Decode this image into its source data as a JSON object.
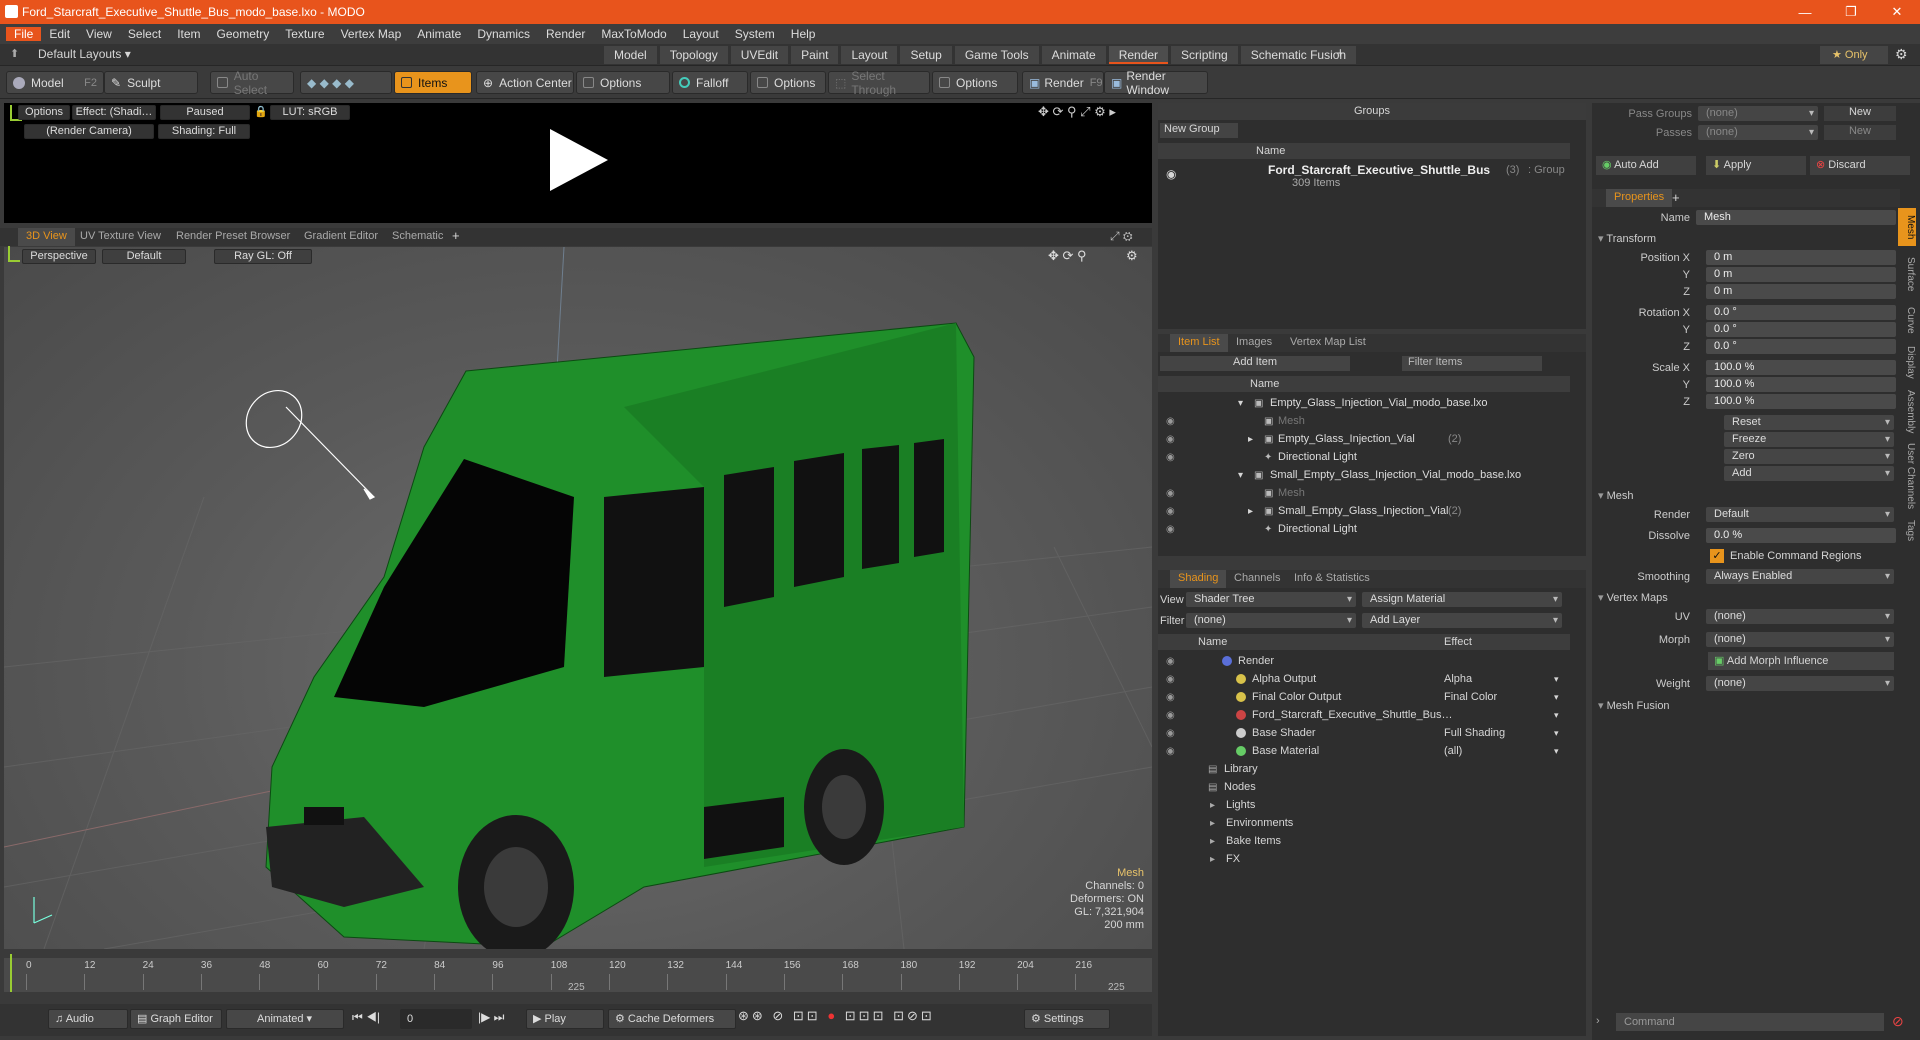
{
  "window": {
    "title": "Ford_Starcraft_Executive_Shuttle_Bus_modo_base.lxo - MODO",
    "min": "—",
    "max": "❐",
    "close": "✕"
  },
  "menu": [
    "File",
    "Edit",
    "View",
    "Select",
    "Item",
    "Geometry",
    "Texture",
    "Vertex Map",
    "Animate",
    "Dynamics",
    "Render",
    "MaxToModo",
    "Layout",
    "System",
    "Help"
  ],
  "layouts": {
    "label": "Default Layouts ▾",
    "tabs": [
      "Model",
      "Topology",
      "UVEdit",
      "Paint",
      "Layout",
      "Setup",
      "Game Tools",
      "Animate",
      "Render",
      "Scripting",
      "Schematic Fusion"
    ],
    "active": "Render",
    "plus": "+",
    "only": "★  Only"
  },
  "toolbar": {
    "model": "Model",
    "model_key": "F2",
    "sculpt": "Sculpt",
    "auto_select": "Auto Select",
    "items": "Items",
    "action_center": "Action Center",
    "options1": "Options",
    "falloff": "Falloff",
    "options2": "Options",
    "select_through": "Select Through",
    "options3": "Options",
    "render": "Render",
    "render_key": "F9",
    "render_window": "Render Window"
  },
  "preview": {
    "options": "Options",
    "effect": "Effect: (Shadi…",
    "paused": "Paused",
    "lut": "LUT: sRGB",
    "camera": "(Render Camera)",
    "shading": "Shading: Full"
  },
  "viewport_tabs": [
    "3D View",
    "UV Texture View",
    "Render Preset Browser",
    "Gradient Editor",
    "Schematic"
  ],
  "viewport": {
    "perspective": "Perspective",
    "default": "Default",
    "raygl": "Ray GL: Off",
    "info": {
      "mesh": "Mesh",
      "channels": "Channels: 0",
      "deformers": "Deformers: ON",
      "gl": "GL: 7,321,904",
      "size": "200 mm"
    }
  },
  "timeline": {
    "ticks": [
      "0",
      "12",
      "24",
      "36",
      "48",
      "60",
      "72",
      "84",
      "96",
      "108",
      "120",
      "132",
      "144",
      "156",
      "168",
      "180",
      "192",
      "204",
      "216"
    ],
    "end_left": "225",
    "end_right": "225"
  },
  "bottom": {
    "audio": "Audio",
    "graph_editor": "Graph Editor",
    "animated": "Animated",
    "frame": "0",
    "play": "Play",
    "cache": "Cache Deformers",
    "settings": "Settings",
    "command": "Command"
  },
  "groups": {
    "title": "Groups",
    "new_group": "New Group",
    "col_name": "Name",
    "item_name": "Ford_Starcraft_Executive_Shuttle_Bus",
    "item_count": "(3)",
    "item_type": ": Group",
    "item_sub": "309 Items"
  },
  "item_list": {
    "tabs": [
      "Item List",
      "Images",
      "Vertex Map List"
    ],
    "add_item": "Add Item",
    "filter": "Filter Items",
    "col_name": "Name",
    "rows": [
      {
        "label": "Empty_Glass_Injection_Vial_modo_base.lxo",
        "indent": 0,
        "arrow": "▾"
      },
      {
        "label": "Mesh",
        "indent": 1,
        "dim": true
      },
      {
        "label": "Empty_Glass_Injection_Vial",
        "count": "(2)",
        "indent": 1,
        "arrow": "▸"
      },
      {
        "label": "Directional Light",
        "indent": 1
      },
      {
        "label": "Small_Empty_Glass_Injection_Vial_modo_base.lxo",
        "indent": 0,
        "arrow": "▾"
      },
      {
        "label": "Mesh",
        "indent": 1,
        "dim": true
      },
      {
        "label": "Small_Empty_Glass_Injection_Vial",
        "count": "(2)",
        "indent": 1,
        "arrow": "▸"
      },
      {
        "label": "Directional Light",
        "indent": 1
      }
    ]
  },
  "shading": {
    "tabs": [
      "Shading",
      "Channels",
      "Info & Statistics"
    ],
    "view_label": "View",
    "view_value": "Shader Tree",
    "assign": "Assign Material",
    "filter_label": "Filter",
    "filter_value": "(none)",
    "add_layer": "Add Layer",
    "col_name": "Name",
    "col_effect": "Effect",
    "rows": [
      {
        "label": "Render",
        "effect": "",
        "indent": 0
      },
      {
        "label": "Alpha Output",
        "effect": "Alpha",
        "indent": 1
      },
      {
        "label": "Final Color Output",
        "effect": "Final Color",
        "indent": 1
      },
      {
        "label": "Ford_Starcraft_Executive_Shuttle_Bus…",
        "effect": "",
        "indent": 1
      },
      {
        "label": "Base Shader",
        "effect": "Full Shading",
        "indent": 1
      },
      {
        "label": "Base Material",
        "effect": "(all)",
        "indent": 1
      },
      {
        "label": "Library",
        "effect": "",
        "indent": 0
      },
      {
        "label": "Nodes",
        "effect": "",
        "indent": 0
      },
      {
        "label": "Lights",
        "effect": "",
        "indent": -1
      },
      {
        "label": "Environments",
        "effect": "",
        "indent": -1
      },
      {
        "label": "Bake Items",
        "effect": "",
        "indent": -1
      },
      {
        "label": "FX",
        "effect": "",
        "indent": -1
      }
    ]
  },
  "passes": {
    "pass_groups": "Pass Groups",
    "pass_groups_val": "(none)",
    "passes": "Passes",
    "passes_val": "(none)",
    "new": "New"
  },
  "actions": {
    "auto_add": "Auto Add",
    "apply": "Apply",
    "discard": "Discard"
  },
  "properties": {
    "tab": "Properties",
    "name_label": "Name",
    "name_value": "Mesh",
    "transform": "Transform",
    "position": [
      "0 m",
      "0 m",
      "0 m"
    ],
    "rotation": [
      "0.0 °",
      "0.0 °",
      "0.0 °"
    ],
    "scale": [
      "100.0 %",
      "100.0 %",
      "100.0 %"
    ],
    "pos_label": "Position X",
    "rot_label": "Rotation X",
    "scale_label": "Scale X",
    "y": "Y",
    "z": "Z",
    "reset": "Reset",
    "freeze": "Freeze",
    "zero": "Zero",
    "add": "Add",
    "mesh": "Mesh",
    "render_label": "Render",
    "render_value": "Default",
    "dissolve_label": "Dissolve",
    "dissolve_value": "0.0 %",
    "enable_cmd": "Enable Command Regions",
    "smoothing_label": "Smoothing",
    "smoothing_value": "Always Enabled",
    "vertex_maps": "Vertex Maps",
    "uv_label": "UV",
    "uv_value": "(none)",
    "morph_label": "Morph",
    "morph_value": "(none)",
    "add_morph": "Add Morph Influence",
    "weight_label": "Weight",
    "weight_value": "(none)",
    "mesh_fusion": "Mesh Fusion",
    "side_tabs": [
      "Mesh",
      "Surface",
      "Curve",
      "Display",
      "Assembly",
      "User Channels",
      "Tags"
    ]
  },
  "colors": {
    "accent": "#e8541c",
    "orange": "#e8941c",
    "bus": "#1f8f2a"
  }
}
